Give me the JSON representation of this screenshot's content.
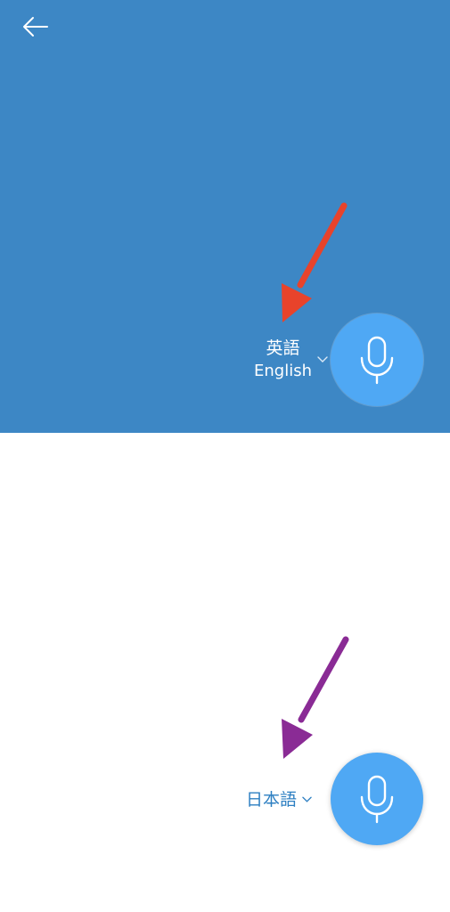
{
  "header": {
    "back_icon": "arrow-left-icon"
  },
  "top_panel": {
    "language_native": "英語",
    "language_english": "English",
    "chevron_icon": "chevron-down-icon",
    "mic_icon": "microphone-icon",
    "background_color": "#3d87c5"
  },
  "bottom_panel": {
    "language_native": "日本語",
    "chevron_icon": "chevron-down-icon",
    "mic_icon": "microphone-icon",
    "text_color": "#2d7fc2"
  },
  "colors": {
    "mic_button": "#4fa8f4",
    "annotation_top_arrow": "#e8432b",
    "annotation_bottom_arrow": "#8a2b95"
  }
}
